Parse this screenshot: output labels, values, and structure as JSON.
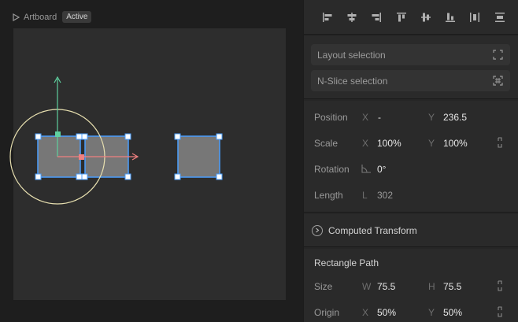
{
  "artboard": {
    "name": "Artboard",
    "status": "Active"
  },
  "align_tools": [
    {
      "icon": "align-left-icon"
    },
    {
      "icon": "align-horizontal-center-icon"
    },
    {
      "icon": "align-right-icon"
    },
    {
      "icon": "align-top-icon"
    },
    {
      "icon": "align-vertical-center-icon"
    },
    {
      "icon": "align-bottom-icon"
    },
    {
      "icon": "distribute-horizontal-icon"
    },
    {
      "icon": "distribute-vertical-icon"
    }
  ],
  "selection": {
    "layout_label": "Layout selection",
    "nslice_label": "N-Slice selection"
  },
  "transform": {
    "position": {
      "label": "Position",
      "x_axis": "X",
      "x_value": "-",
      "y_axis": "Y",
      "y_value": "236.5"
    },
    "scale": {
      "label": "Scale",
      "x_axis": "X",
      "x_value": "100%",
      "y_axis": "Y",
      "y_value": "100%"
    },
    "rotation": {
      "label": "Rotation",
      "value": "0°"
    },
    "length": {
      "label": "Length",
      "axis": "L",
      "value": "302"
    }
  },
  "computed_transform": {
    "label": "Computed Transform"
  },
  "rectangle_path": {
    "title": "Rectangle Path",
    "size": {
      "label": "Size",
      "w_axis": "W",
      "w_value": "75.5",
      "h_axis": "H",
      "h_value": "75.5"
    },
    "origin": {
      "label": "Origin",
      "x_axis": "X",
      "x_value": "50%",
      "y_axis": "Y",
      "y_value": "50%"
    }
  },
  "colors": {
    "selection_blue": "#4a9eff",
    "gizmo_green": "#5fcf9f",
    "gizmo_red": "#f08080",
    "rotation_ring": "#e8e0b0",
    "shape_fill": "#777777"
  }
}
